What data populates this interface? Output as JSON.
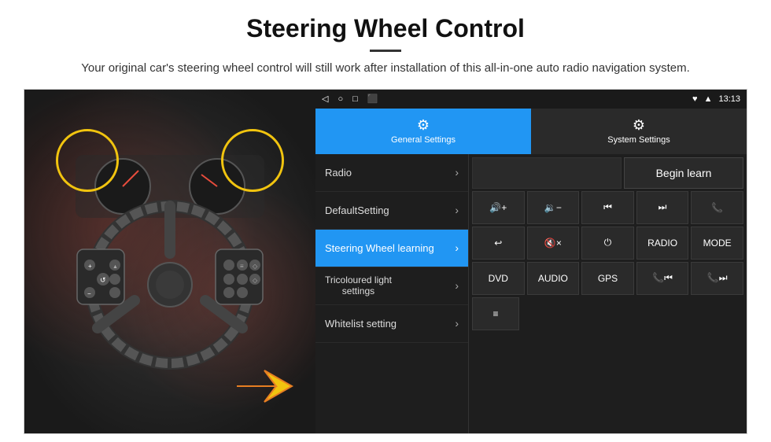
{
  "header": {
    "title": "Steering Wheel Control",
    "divider": true,
    "subtitle": "Your original car's steering wheel control will still work after installation of this all-in-one auto radio navigation system."
  },
  "status_bar": {
    "time": "13:13",
    "icons": [
      "◁",
      "○",
      "□",
      "⬛",
      "♥",
      "▲"
    ]
  },
  "tabs": [
    {
      "id": "general",
      "label": "General Settings",
      "active": true
    },
    {
      "id": "system",
      "label": "System Settings",
      "active": false
    }
  ],
  "menu": [
    {
      "id": "radio",
      "label": "Radio",
      "active": false
    },
    {
      "id": "default",
      "label": "DefaultSetting",
      "active": false
    },
    {
      "id": "steering",
      "label": "Steering Wheel learning",
      "active": true
    },
    {
      "id": "tricolour",
      "label": "Tricoloured light settings",
      "active": false
    },
    {
      "id": "whitelist",
      "label": "Whitelist setting",
      "active": false
    }
  ],
  "button_panel": {
    "begin_learn_label": "Begin learn",
    "rows": [
      {
        "id": "row1",
        "buttons": [
          {
            "id": "vol_up",
            "label": "🔊+",
            "type": "icon"
          },
          {
            "id": "vol_down",
            "label": "🔉−",
            "type": "icon"
          },
          {
            "id": "prev_track",
            "label": "⏮",
            "type": "icon"
          },
          {
            "id": "next_track",
            "label": "⏭",
            "type": "icon"
          },
          {
            "id": "phone",
            "label": "📞",
            "type": "icon"
          }
        ]
      },
      {
        "id": "row2",
        "buttons": [
          {
            "id": "hang_up",
            "label": "↩",
            "type": "icon"
          },
          {
            "id": "mute",
            "label": "🔇×",
            "type": "icon"
          },
          {
            "id": "power",
            "label": "⏻",
            "type": "icon"
          },
          {
            "id": "radio_btn",
            "label": "RADIO",
            "type": "text"
          },
          {
            "id": "mode_btn",
            "label": "MODE",
            "type": "text"
          }
        ]
      },
      {
        "id": "row3",
        "buttons": [
          {
            "id": "dvd_btn",
            "label": "DVD",
            "type": "text"
          },
          {
            "id": "audio_btn",
            "label": "AUDIO",
            "type": "text"
          },
          {
            "id": "gps_btn",
            "label": "GPS",
            "type": "text"
          },
          {
            "id": "tel_prev",
            "label": "📞⏮",
            "type": "icon"
          },
          {
            "id": "tel_next",
            "label": "📞⏭",
            "type": "icon"
          }
        ]
      },
      {
        "id": "row4",
        "buttons": [
          {
            "id": "list_btn",
            "label": "≡",
            "type": "icon"
          }
        ]
      }
    ]
  }
}
